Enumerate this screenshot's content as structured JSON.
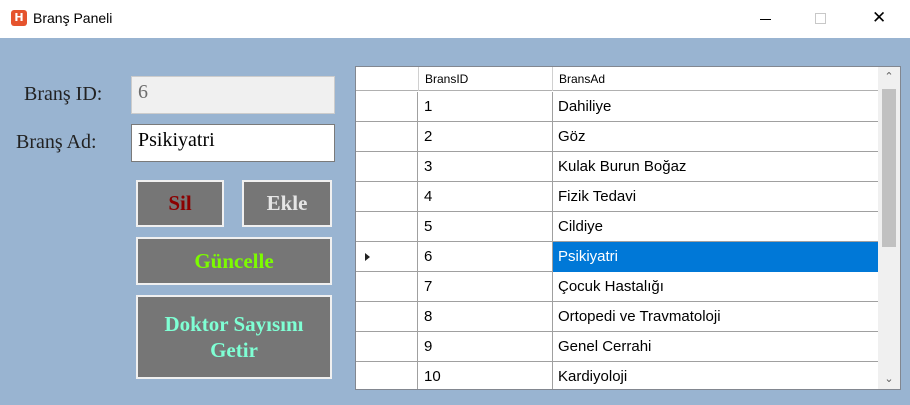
{
  "window": {
    "title": "Branş Paneli",
    "icon_letter": "H",
    "close_glyph": "✕"
  },
  "form": {
    "brans_id_label": "Branş ID:",
    "brans_id_value": "6",
    "brans_ad_label": "Branş Ad:",
    "brans_ad_value": "Psikiyatri"
  },
  "buttons": {
    "sil": "Sil",
    "ekle": "Ekle",
    "guncelle": "Güncelle",
    "doktor_line1": "Doktor Sayısını",
    "doktor_line2": "Getir"
  },
  "colors": {
    "client_bg": "#99b4d1",
    "button_bg": "#767676",
    "sil_text": "#8b0000",
    "ekle_text": "#e6e6e6",
    "guncelle_text": "#7cfc00",
    "doktor_text": "#7fffd4",
    "selection": "#0078d7"
  },
  "grid": {
    "columns": [
      "BransID",
      "BransAd"
    ],
    "rows": [
      {
        "id": "1",
        "ad": "Dahiliye"
      },
      {
        "id": "2",
        "ad": "Göz"
      },
      {
        "id": "3",
        "ad": "Kulak Burun Boğaz"
      },
      {
        "id": "4",
        "ad": "Fizik Tedavi"
      },
      {
        "id": "5",
        "ad": "Cildiye"
      },
      {
        "id": "6",
        "ad": "Psikiyatri"
      },
      {
        "id": "7",
        "ad": "Çocuk Hastalığı"
      },
      {
        "id": "8",
        "ad": "Ortopedi ve Travmatoloji"
      },
      {
        "id": "9",
        "ad": "Genel Cerrahi"
      },
      {
        "id": "10",
        "ad": "Kardiyoloji"
      }
    ],
    "selected_index": 5,
    "scroll_up_glyph": "⌃",
    "scroll_down_glyph": "⌄"
  }
}
